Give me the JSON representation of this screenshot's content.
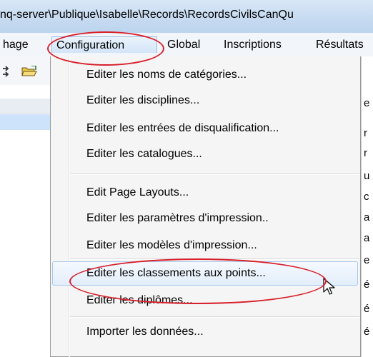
{
  "window": {
    "title": "nq-server\\Publique\\Isabelle\\Records\\RecordsCivilsCanQu"
  },
  "menubar": {
    "items": [
      {
        "label": "hage"
      },
      {
        "label": "Configuration"
      },
      {
        "label": "Global"
      },
      {
        "label": "Inscriptions"
      },
      {
        "label": "Résultats"
      }
    ]
  },
  "toolbar": {
    "icons": [
      "arrows-icon",
      "open-folder-icon"
    ]
  },
  "right_edge": {
    "chars": [
      "e",
      "r",
      "r",
      "u",
      "c",
      "a",
      "a",
      "e",
      "é",
      "é",
      "é"
    ]
  },
  "dropdown": {
    "items": [
      {
        "label": "Editer les noms de catégories..."
      },
      {
        "label": "Editer les disciplines..."
      },
      {
        "label": "Editer les entrées de disqualification..."
      },
      {
        "label": "Editer les catalogues..."
      },
      {
        "label": "Edit Page Layouts..."
      },
      {
        "label": "Editer les paramètres d'impression.."
      },
      {
        "label": "Editer les modèles d'impression..."
      },
      {
        "label": "Editer les classements aux points..."
      },
      {
        "label": "Editer les diplômes..."
      },
      {
        "label": "Importer les données..."
      }
    ]
  },
  "colors": {
    "callout": "#d81f2a",
    "hover_border": "#a8c8ec",
    "selection": "#cde3fb"
  }
}
